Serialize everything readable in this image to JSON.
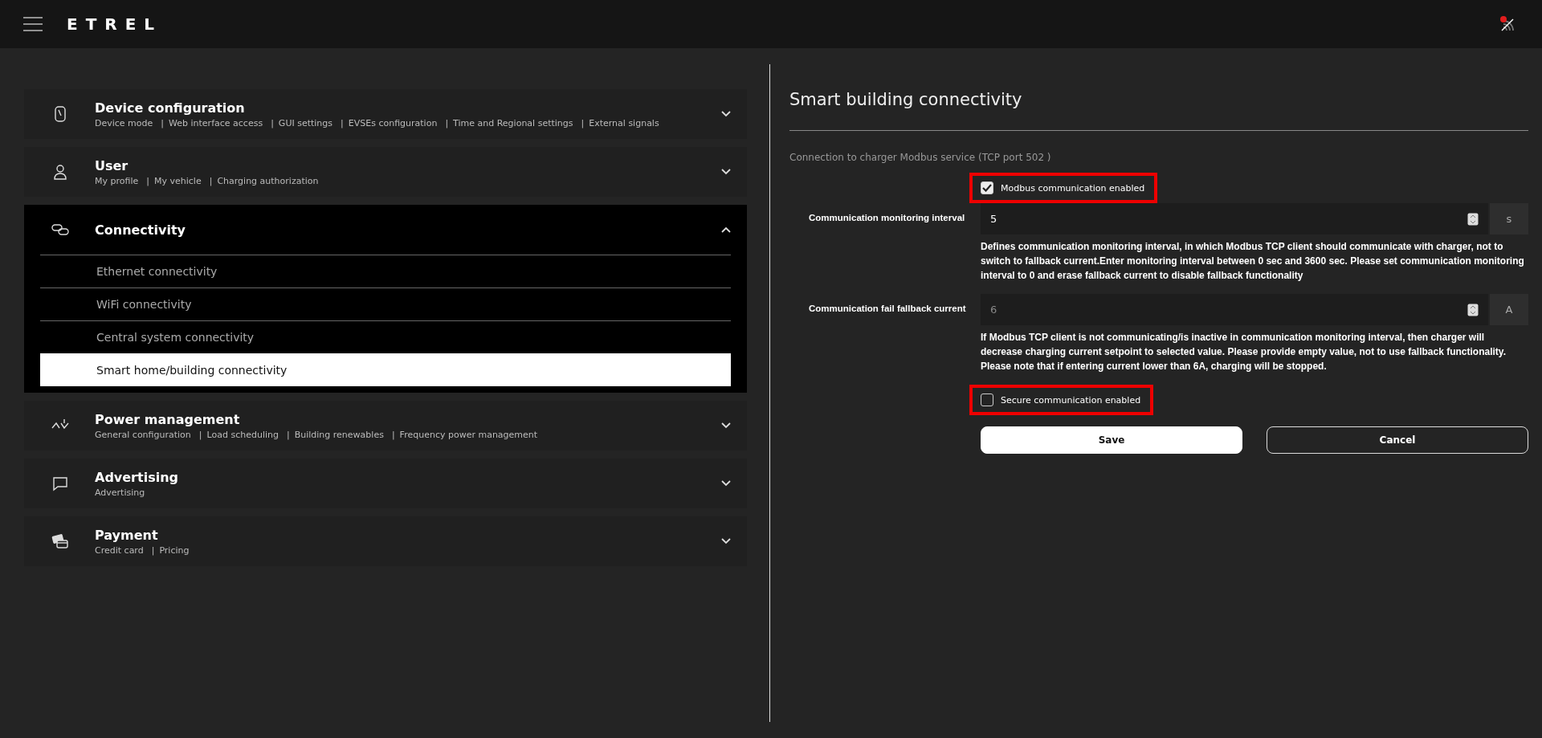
{
  "header": {
    "logo": "ETREL"
  },
  "link_separator": "|",
  "sections": [
    {
      "title": "Device configuration",
      "expanded": false,
      "links": [
        "Device mode",
        "Web interface access",
        "GUI settings",
        "EVSEs configuration",
        "Time and Regional settings",
        "External signals"
      ]
    },
    {
      "title": "User",
      "expanded": false,
      "links": [
        "My profile",
        "My vehicle",
        "Charging authorization"
      ]
    },
    {
      "title": "Connectivity",
      "expanded": true,
      "children": [
        {
          "label": "Ethernet connectivity",
          "selected": false
        },
        {
          "label": "WiFi connectivity",
          "selected": false
        },
        {
          "label": "Central system connectivity",
          "selected": false
        },
        {
          "label": "Smart home/building connectivity",
          "selected": true
        }
      ]
    },
    {
      "title": "Power management",
      "expanded": false,
      "links": [
        "General configuration",
        "Load scheduling",
        "Building renewables",
        "Frequency power management"
      ]
    },
    {
      "title": "Advertising",
      "expanded": false,
      "links": [
        "Advertising"
      ]
    },
    {
      "title": "Payment",
      "expanded": false,
      "links": [
        "Credit card",
        "Pricing"
      ]
    }
  ],
  "panel": {
    "title": "Smart building connectivity",
    "subtitle": "Connection to charger Modbus service (TCP port 502 )",
    "items": [
      {
        "kind": "checkbox",
        "label": "Modbus communication enabled",
        "checked": true,
        "highlighted": true
      },
      {
        "kind": "field",
        "label": "Communication monitoring interval",
        "value": "5",
        "unit": "s",
        "disabled": false,
        "help": "Defines communication monitoring interval, in which Modbus TCP client should communicate with charger, not to switch to fallback current.Enter monitoring interval between 0 sec and 3600 sec. Please set communication monitoring interval to 0 and erase fallback current to disable fallback functionality"
      },
      {
        "kind": "field",
        "label": "Communication fail fallback current",
        "value": "6",
        "unit": "A",
        "disabled": true,
        "help": "If Modbus TCP client is not communicating/is inactive in communication monitoring interval, then charger will decrease charging current setpoint to selected value. Please provide empty value, not to use fallback functionality. Please note that if entering current lower than 6A, charging will be stopped."
      },
      {
        "kind": "checkbox",
        "label": "Secure communication enabled",
        "checked": false,
        "highlighted": true
      }
    ],
    "buttons": [
      {
        "label": "Save",
        "kind": "primary"
      },
      {
        "label": "Cancel",
        "kind": "secondary"
      }
    ]
  }
}
